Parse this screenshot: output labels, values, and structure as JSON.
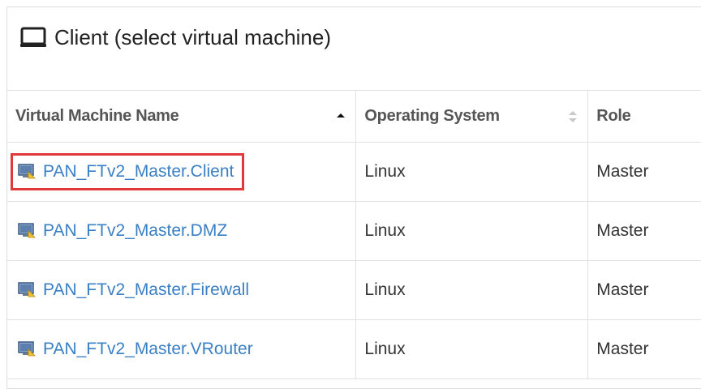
{
  "panel": {
    "title": "Client (select virtual machine)",
    "icon": "monitor-icon"
  },
  "table": {
    "columns": [
      {
        "label": "Virtual Machine Name",
        "sort": "ascending"
      },
      {
        "label": "Operating System",
        "sort": "none"
      },
      {
        "label": "Role",
        "sort": "none"
      }
    ],
    "rows": [
      {
        "name": "PAN_FTv2_Master.Client",
        "os": "Linux",
        "role": "Master",
        "highlighted": true
      },
      {
        "name": "PAN_FTv2_Master.DMZ",
        "os": "Linux",
        "role": "Master",
        "highlighted": false
      },
      {
        "name": "PAN_FTv2_Master.Firewall",
        "os": "Linux",
        "role": "Master",
        "highlighted": false
      },
      {
        "name": "PAN_FTv2_Master.VRouter",
        "os": "Linux",
        "role": "Master",
        "highlighted": false
      }
    ]
  },
  "colors": {
    "link": "#3a7fc4",
    "highlight_border": "#e0393b",
    "border": "#e2e2e2"
  }
}
